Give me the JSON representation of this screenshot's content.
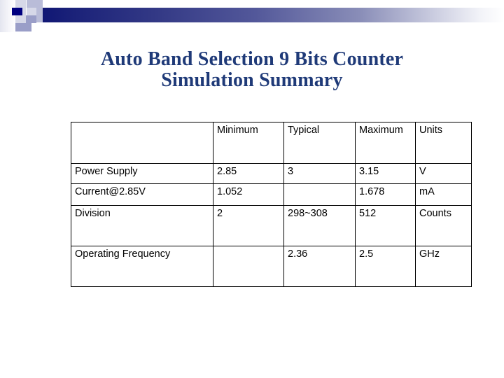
{
  "slide": {
    "decor": {
      "accent_navy": "#000080",
      "accent_lavender": "#b9bcd8",
      "bar_gradient_start": "#0b1172",
      "bar_gradient_end": "#ffffff"
    },
    "title": {
      "color": "#1f3a78",
      "line1": "Auto Band Selection 9 Bits Counter",
      "line2": "Simulation Summary"
    }
  },
  "table": {
    "columns": [
      "",
      "Minimum",
      "Typical",
      "Maximum",
      "Units"
    ],
    "rows": [
      {
        "parameter": "Power Supply",
        "minimum": "2.85",
        "typical": "3",
        "maximum": "3.15",
        "units": "V"
      },
      {
        "parameter": "Current@2.85V",
        "minimum": "1.052",
        "typical": "",
        "maximum": "1.678",
        "units": "mA"
      },
      {
        "parameter": "Division",
        "minimum": "2",
        "typical": "298~308",
        "maximum": "512",
        "units": "Counts"
      },
      {
        "parameter": "Operating Frequency",
        "minimum": "",
        "typical": "2.36",
        "maximum": "2.5",
        "units": "GHz"
      }
    ]
  }
}
